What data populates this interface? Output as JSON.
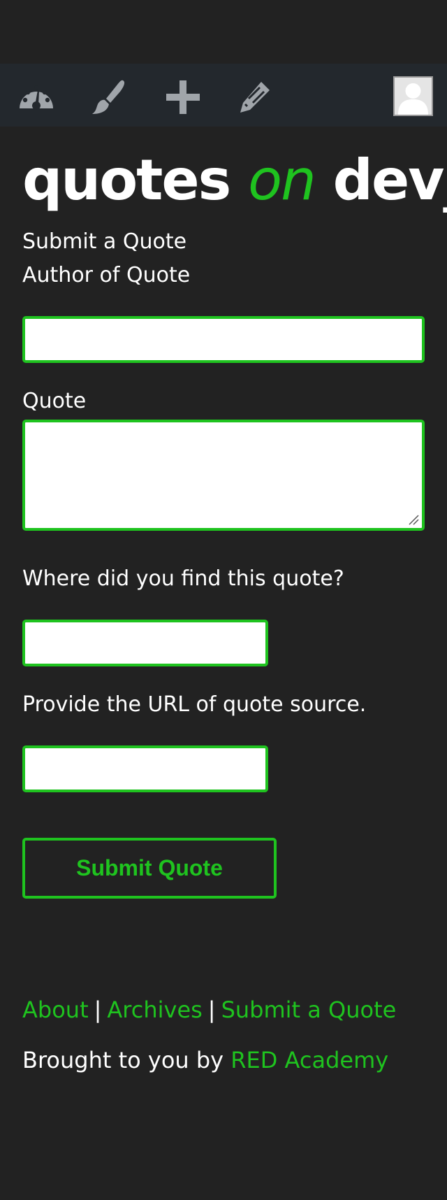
{
  "admin_bar": {
    "icons": [
      "dashboard-icon",
      "customize-brush-icon",
      "add-new-plus-icon",
      "edit-pencil-icon"
    ],
    "avatar_icon": "user-avatar-icon",
    "background": "#23282d",
    "icon_color": "#a0a5aa"
  },
  "site": {
    "title_part1": "quotes",
    "title_part2": "on",
    "title_part3": "dev_"
  },
  "form": {
    "heading": "Submit a Quote",
    "author_label": "Author of Quote",
    "author_value": "",
    "quote_label": "Quote",
    "quote_value": "",
    "source_label": "Where did you find this quote?",
    "source_value": "",
    "url_label": "Provide the URL of quote source.",
    "url_value": "",
    "submit_label": "Submit Quote"
  },
  "footer": {
    "nav": [
      "About",
      "Archives",
      "Submit a Quote"
    ],
    "separator": "|",
    "credit_prefix": "Brought to you by",
    "credit_link": "RED Academy"
  },
  "colors": {
    "accent": "#1fc31f",
    "background": "#222222",
    "text": "#ffffff"
  }
}
